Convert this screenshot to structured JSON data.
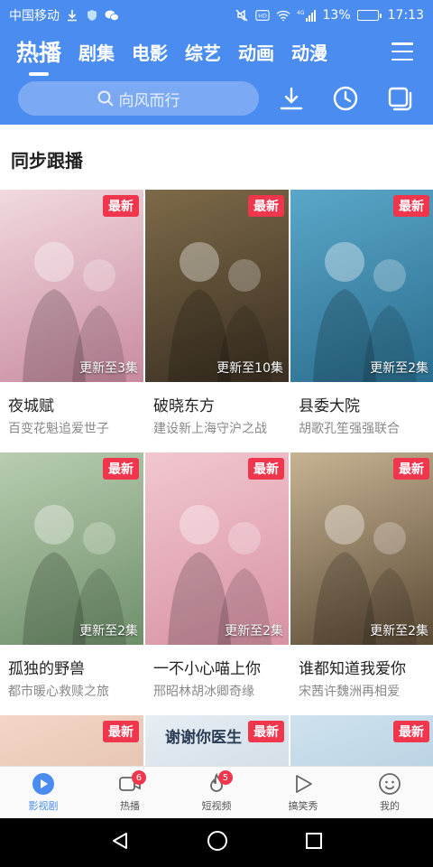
{
  "status_bar": {
    "carrier": "中国移动",
    "network": "4G",
    "battery_percent": "13%",
    "battery_level": 0.13,
    "time": "17:13"
  },
  "tabs": [
    {
      "label": "热播",
      "active": true
    },
    {
      "label": "剧集"
    },
    {
      "label": "电影"
    },
    {
      "label": "综艺"
    },
    {
      "label": "动画"
    },
    {
      "label": "动漫"
    }
  ],
  "search": {
    "placeholder": "向风而行"
  },
  "section": {
    "title": "同步跟播"
  },
  "cards": [
    {
      "title": "夜城赋",
      "subtitle": "百变花魁追爱世子",
      "badge": "最新",
      "update": "更新至3集",
      "poster_colors": [
        "#f1d9df",
        "#c98aa0"
      ]
    },
    {
      "title": "破晓东方",
      "subtitle": "建设新上海守沪之战",
      "badge": "最新",
      "update": "更新至10集",
      "poster_colors": [
        "#7d6a48",
        "#3a2f22"
      ]
    },
    {
      "title": "县委大院",
      "subtitle": "胡歌孔笙强强联合",
      "badge": "最新",
      "update": "更新至2集",
      "poster_colors": [
        "#5aa7c9",
        "#2a6d8e"
      ]
    },
    {
      "title": "孤独的野兽",
      "subtitle": "都市暖心救赎之旅",
      "badge": "最新",
      "update": "更新至2集",
      "poster_colors": [
        "#b9cdb0",
        "#6e8f6a"
      ]
    },
    {
      "title": "一不小心喵上你",
      "subtitle": "邢昭林胡冰卿奇缘",
      "badge": "最新",
      "update": "更新至2集",
      "poster_colors": [
        "#f2c7cf",
        "#d792a3"
      ]
    },
    {
      "title": "谁都知道我爱你",
      "subtitle": "宋茜许魏洲再相爱",
      "badge": "最新",
      "update": "更新至2集",
      "poster_colors": [
        "#c7b393",
        "#5b4a35"
      ]
    },
    {
      "title": "",
      "subtitle": "",
      "badge": "最新",
      "update": "",
      "poster_colors": [
        "#f2d6c6",
        "#d9b09c"
      ]
    },
    {
      "title": "",
      "subtitle": "",
      "badge": "最新",
      "update": "",
      "poster_caption": "谢谢你医生",
      "poster_colors": [
        "#e7eef4",
        "#b9c9d6"
      ]
    },
    {
      "title": "",
      "subtitle": "",
      "badge": "最新",
      "update": "",
      "poster_colors": [
        "#cfe2ee",
        "#9fc0d6"
      ]
    }
  ],
  "bottom_nav": [
    {
      "label": "影视剧",
      "icon": "play-icon",
      "active": true
    },
    {
      "label": "热播",
      "icon": "camera-icon",
      "badge": "6"
    },
    {
      "label": "短视频",
      "icon": "flame-icon",
      "badge": "5"
    },
    {
      "label": "搞笑秀",
      "icon": "play-outline-icon"
    },
    {
      "label": "我的",
      "icon": "smile-icon"
    }
  ],
  "colors": {
    "primary": "#4b8cf0",
    "badge": "#f0364c"
  }
}
